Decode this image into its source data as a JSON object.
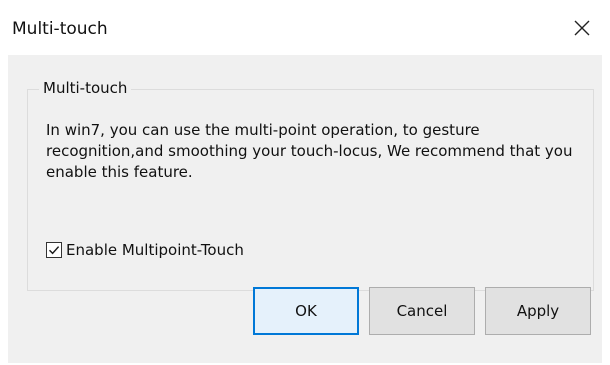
{
  "window": {
    "title": "Multi-touch"
  },
  "group": {
    "legend": "Multi-touch",
    "description": "In win7, you can use the multi-point operation, to gesture recognition,and smoothing your touch-locus, We recommend that you enable this feature."
  },
  "checkbox": {
    "label": "Enable Multipoint-Touch",
    "checked": true
  },
  "buttons": {
    "ok": "OK",
    "cancel": "Cancel",
    "apply": "Apply"
  },
  "icons": {
    "close": "close-icon",
    "check": "checkmark-icon"
  },
  "colors": {
    "accent": "#0078d7",
    "dialog_background": "#f0f0f0"
  }
}
